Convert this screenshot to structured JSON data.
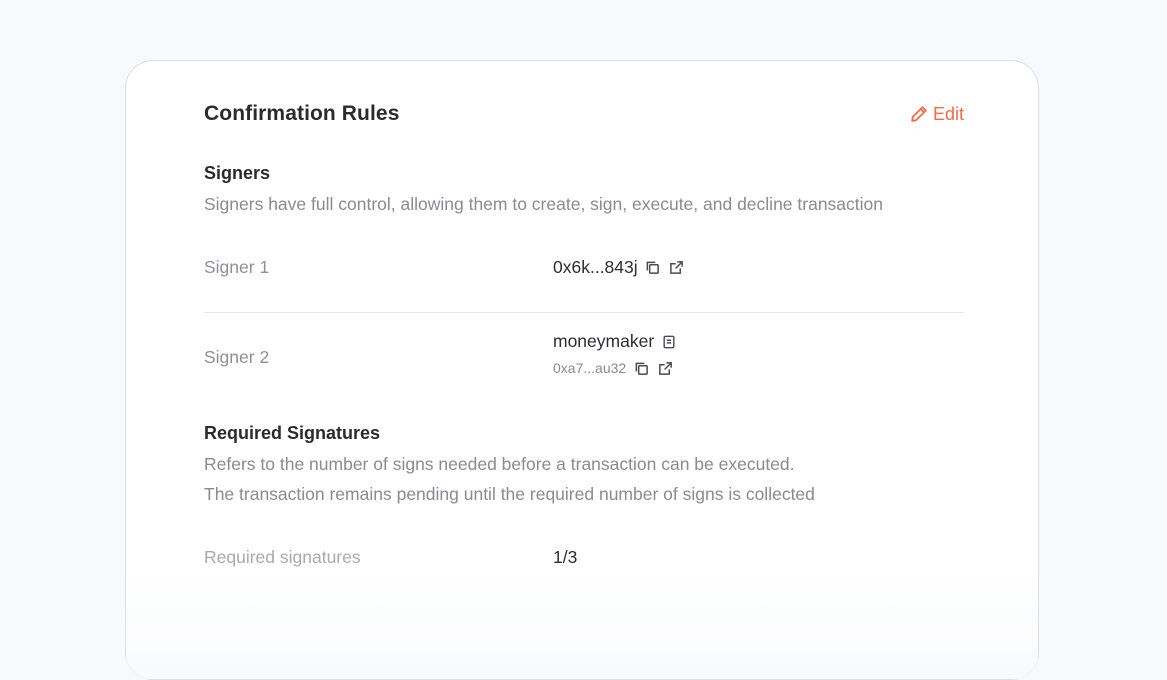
{
  "card": {
    "title": "Confirmation Rules",
    "edit_label": "Edit"
  },
  "signers": {
    "title": "Signers",
    "description": "Signers have full control, allowing them to create, sign, execute, and decline transaction",
    "items": [
      {
        "label": "Signer 1",
        "address": "0x6k...843j"
      },
      {
        "label": "Signer 2",
        "name": "moneymaker",
        "address": "0xa7...au32"
      }
    ]
  },
  "required_signatures": {
    "title": "Required Signatures",
    "description_line1": "Refers to the number of signs needed before a transaction can be executed.",
    "description_line2": "The transaction remains pending until the required number of signs is collected",
    "row_label": "Required signatures",
    "row_value": "1/3"
  },
  "colors": {
    "accent": "#f26b45",
    "text_primary": "#2a2a2f",
    "text_muted": "#8a8a93",
    "divider": "#e6e7ee"
  },
  "icons": {
    "edit": "pencil-icon",
    "copy": "copy-icon",
    "external": "external-link-icon",
    "note": "note-icon"
  }
}
